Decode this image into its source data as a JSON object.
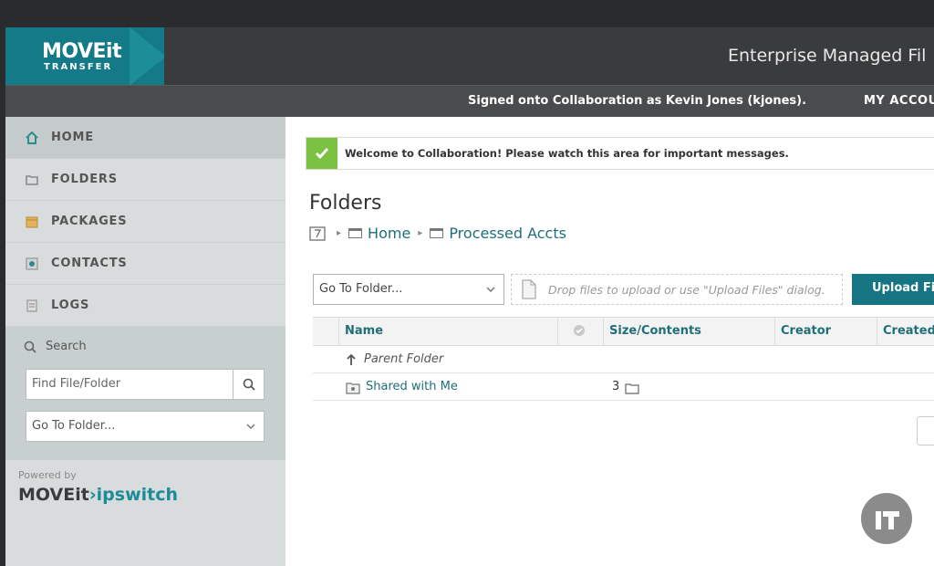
{
  "header": {
    "logo_text": "MOVEit",
    "logo_subtext": "TRANSFER",
    "app_title": "Enterprise Managed Fil",
    "signed_in": "Signed onto Collaboration as Kevin Jones (kjones).",
    "my_account": "MY ACCOU"
  },
  "sidebar": {
    "items": [
      {
        "label": "HOME",
        "icon": "home-icon"
      },
      {
        "label": "FOLDERS",
        "icon": "folder-icon"
      },
      {
        "label": "PACKAGES",
        "icon": "package-icon"
      },
      {
        "label": "CONTACTS",
        "icon": "contacts-icon"
      },
      {
        "label": "LOGS",
        "icon": "logs-icon"
      }
    ],
    "search": {
      "label": "Search",
      "find_placeholder": "Find File/Folder",
      "goto_value": "Go To Folder..."
    },
    "powered_by": "Powered by",
    "brand_moveit": "MOVEit",
    "brand_sep": "›",
    "brand_ipswitch": "ipswitch"
  },
  "main": {
    "message": "Welcome to Collaboration! Please watch this area for important messages.",
    "title": "Folders",
    "breadcrumb": [
      "Home",
      "Processed Accts"
    ],
    "goto_value": "Go To Folder...",
    "drop_text": "Drop files to upload or use \"Upload Files\" dialog.",
    "upload_label": "Upload File",
    "table": {
      "headers": [
        "Name",
        "Size/Contents",
        "Creator",
        "Created"
      ],
      "rows": [
        {
          "name": "Parent Folder",
          "size": ""
        },
        {
          "name": "Shared with Me",
          "size": "3"
        }
      ]
    }
  },
  "colors": {
    "accent": "#167583",
    "header_bg": "#3a3b3d",
    "sidebar_bg": "#d9dcdc",
    "success": "#7cc242"
  }
}
